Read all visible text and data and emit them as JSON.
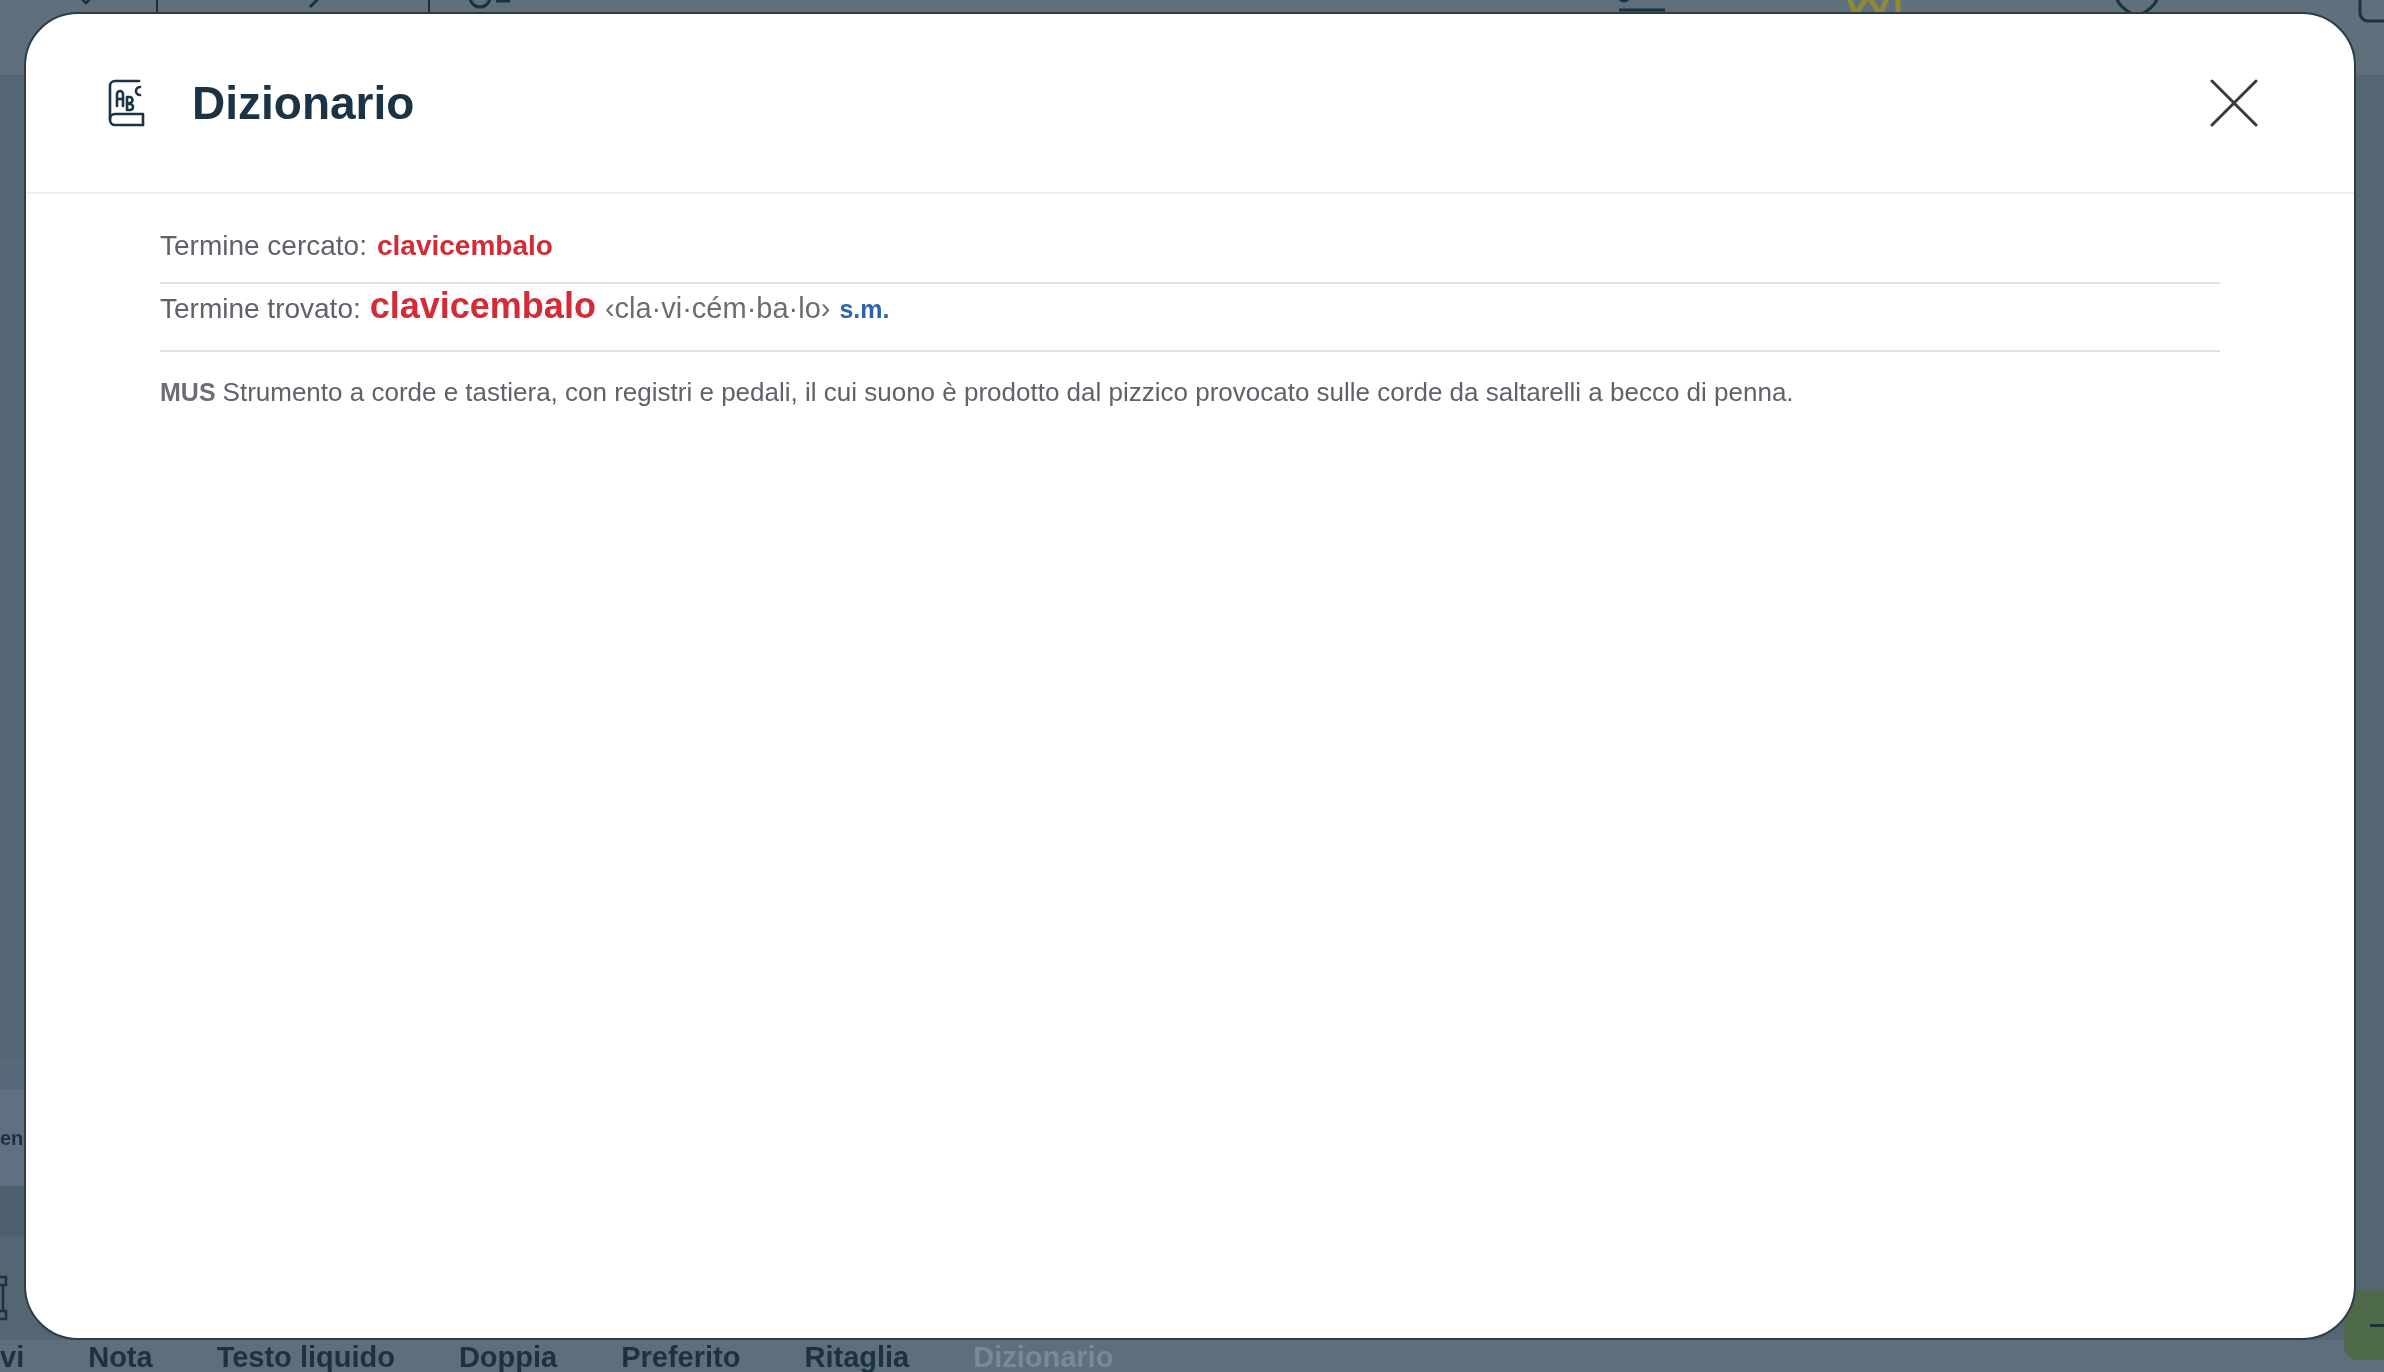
{
  "side_panel": {
    "label": "en"
  },
  "toolbar": [
    {
      "label": "vi",
      "disabled": false
    },
    {
      "label": "Nota",
      "disabled": false
    },
    {
      "label": "Testo liquido",
      "disabled": false
    },
    {
      "label": "Doppia",
      "disabled": false
    },
    {
      "label": "Preferito",
      "disabled": false
    },
    {
      "label": "Ritaglia",
      "disabled": false
    },
    {
      "label": "Dizionario",
      "disabled": true
    }
  ],
  "dialog": {
    "title": "Dizionario",
    "searched": {
      "label": "Termine cercato:",
      "term": "clavicembalo"
    },
    "found": {
      "label": "Termine trovato:",
      "term": "clavicembalo",
      "syllabification": "‹cla·vi·cém·ba·lo›",
      "grammar": "s.m."
    },
    "definitions": [
      {
        "domain": "MUS",
        "text": "Strumento a corde e tastiera, con registri e pedali, il cui suono è prodotto dal pizzico provocato sulle corde da saltarelli a becco di penna."
      }
    ]
  }
}
